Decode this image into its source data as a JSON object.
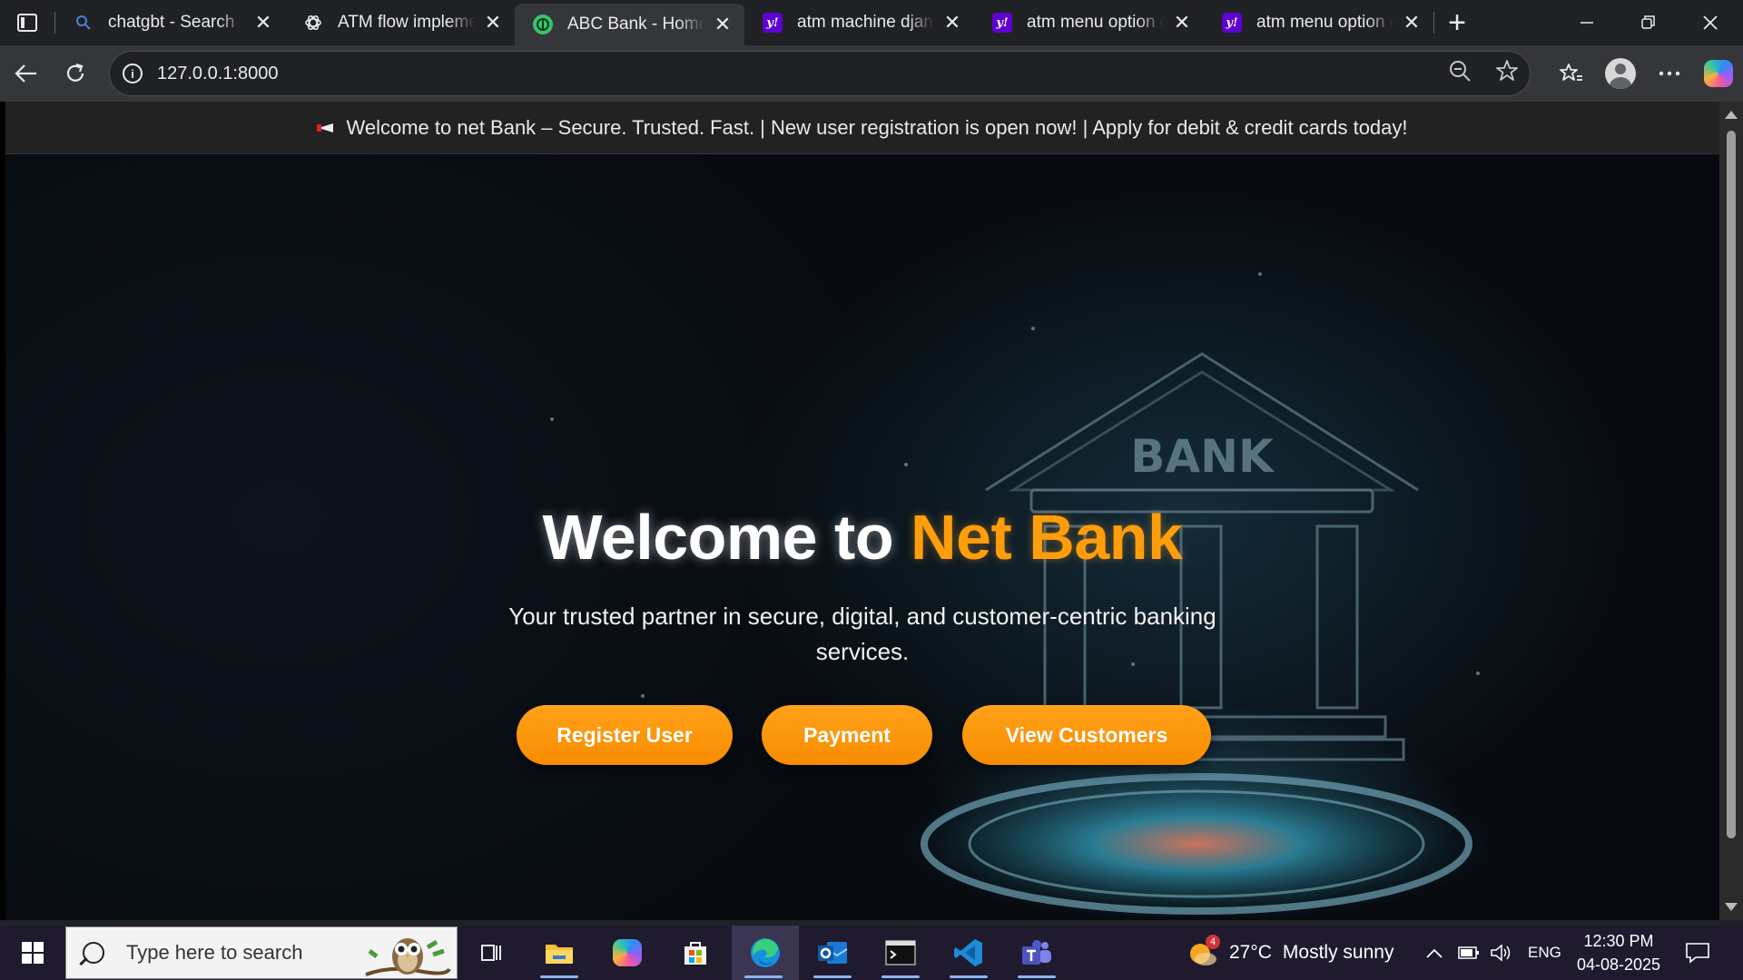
{
  "browser": {
    "tabs": [
      {
        "title": "chatgbt - Search",
        "favicon": "search-icon",
        "active": false
      },
      {
        "title": "ATM flow implementation",
        "favicon": "chatgpt-icon",
        "active": false
      },
      {
        "title": "ABC Bank - Home",
        "favicon": "bank-site-icon",
        "active": true
      },
      {
        "title": "atm machine django",
        "favicon": "yahoo-icon",
        "active": false
      },
      {
        "title": "atm menu option de",
        "favicon": "yahoo-icon",
        "active": false
      },
      {
        "title": "atm menu option de",
        "favicon": "yahoo-icon",
        "active": false
      }
    ],
    "url": "127.0.0.1:8000"
  },
  "page": {
    "ticker": "Welcome to net Bank – Secure. Trusted. Fast. | New user registration is open now! | Apply for debit & credit cards today!",
    "hero": {
      "title_prefix": "Welcome to ",
      "title_accent": "Net Bank",
      "subtitle": "Your trusted partner in secure, digital, and customer-centric banking services.",
      "background_text": "BANK",
      "buttons": {
        "register": "Register User",
        "payment": "Payment",
        "customers": "View Customers"
      }
    },
    "colors": {
      "accent": "#ff9d0a",
      "button": "#f78c00",
      "ticker_bg": "#222222"
    }
  },
  "taskbar": {
    "search_placeholder": "Type here to search",
    "apps": [
      "task-view-icon",
      "file-explorer-icon",
      "copilot-icon",
      "microsoft-store-icon",
      "edge-icon",
      "outlook-icon",
      "terminal-icon",
      "vscode-icon",
      "teams-icon"
    ],
    "weather": {
      "temp": "27°C",
      "desc": "Mostly sunny",
      "badge": "4"
    },
    "language": "ENG",
    "time": "12:30 PM",
    "date": "04-08-2025"
  }
}
